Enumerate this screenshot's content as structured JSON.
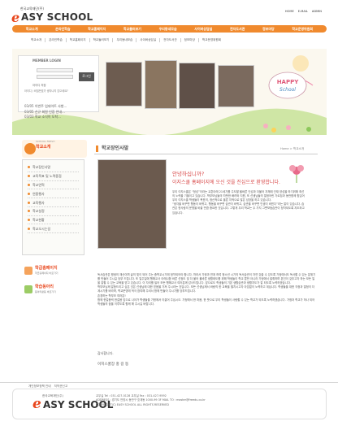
{
  "header": {
    "logo_small": "한국교육재단(주)",
    "logo_e": "e",
    "logo_rest": "ASY SCHOOL",
    "top_links": [
      "HOME",
      "E-MAIL",
      "ADMIN"
    ]
  },
  "gnb": [
    "학교소개",
    "온라인학습",
    "학교홈페이지",
    "학교둘러보기",
    "우리동네모습",
    "사이버상담실",
    "전자도서관",
    "정보마당",
    "학교운영위원회"
  ],
  "subnav": [
    "학교소개",
    "온라인학습",
    "학교홈페이지",
    "학교둘러보기",
    "우리동네모습",
    "사이버상담실",
    "전자도서관",
    "정보마당",
    "학교운영위원회"
  ],
  "login": {
    "title": "MEMBER LOGIN",
    "button": "로그인",
    "remember": "아이디 저장",
    "links": "아이디 / 비밀번호가 생각나지 않으세요?",
    "notices": [
      {
        "date": "03/05",
        "text": "이번주 업데이트 사항..."
      },
      {
        "date": "03/05",
        "text": "신규 회원 인증 안내..."
      },
      {
        "date": "03/03",
        "text": "학교 소식이 도착..."
      }
    ]
  },
  "visual": {
    "happy": "HAPPY School"
  },
  "lnb": {
    "head_small": "SCHOOL FRESH",
    "head": "학교소개",
    "items": [
      "학교장인사말",
      "교육목표 및 노력중점",
      "학교연혁",
      "연중행사",
      "교육행사",
      "학교실정",
      "학교현황",
      "학교오시는길"
    ]
  },
  "banners": [
    {
      "title": "학급홈페이지",
      "sub": "학급홈페이지 바로가기"
    },
    {
      "title": "학습동아리",
      "sub": "동아리활동 바로가기"
    }
  ],
  "content": {
    "title": "학교장인사말",
    "breadcrumb": "Home > 학교소개",
    "hello": "안녕하십니까?",
    "welcome": "이지스쿨 홈페이지에 오신 것을 진심으로 환영합니다.",
    "para1": "우리 이지스쿨은 “정성”이라는 교훈아래 21세기를 주도할 올바른 인성과 더불어 자체에 인재 양성을 하기위해 최선의 노력을 기울이고 있습니다. 학부모님들의 따뜻한 배려와 지원, 또 선생님들의 열정어린 가르침과 동반함께 힘입어 우리 이지스쿨 학생들이 목표의, 정신적으로 올른 지적으로 많은 성장을 하고 있습니다.\n“생각을 바꾸면 행동이 바뀌고, 행동을 바꾸면 습관이 바뀌고, 습관을 바꾸면 인생이 바뀐다”라는 말이 있습니다. 습관은 한사람의 운명을 바꿀 만큼 중요한 것입니다. 그렇게 우리 학교는 두 가지 그릇보듬습관이 정착되도록 지도하고 있습니다.",
    "para2": "독서습관은 평생의 재산이며 삶의 빛이 되어 주는 중학교시기에 정착되어야 합니다. 따라서 가정과 연계 하여 청소년 시기의 독서습관이 자연 갖출 수 있도록 가정에서도 독서할 수 있는 분위기를 만들어 주시길 당부 드립니다. 또 일주일에 행해교사 아래나환 바른 선정도 및 더 불어 올바른 생활태도를 위해 학생들이 학교 뿐만 아니라 가정에서 발휘하며 본인이 갖추고자 하는 모든 일을 잘할 수 있는 교육을 받고 있습니다. 이 자리를 빌어 모든 행해교사 여러분께 감사드립니다. 앞으로도 학생들의 기본 생활습관과 생활지도가 잘 되도록 노력하겠습니다.\n학부모님께 말씀드리고 싶은 것은 선생님에 대한 믿음을 가져 주시라는 것입니다. 모든 선생님께서 바람직 한 교육을 펼치시고자 아낌없이 노력하고 계십니다. 학생들을 대한 걱정과 열정이 더 계시기를 바라며, 학교운영에 적극 참여해 주셔서 함께 만들어 주시기를 당부드립니다.\n존경하는 학부모 여러분!\n함께 한걸음씩 한걸음 앞으로 나아가 학생들을 가정에서 이끌어 주십시오. 가정에서 한 마음, 한 뜻으로 우리 학생들이 사랑할 수 있는 학교가 되도록 노력하겠습니다. 가정과 학교가 하나 되어 학생들의 꿈을 이루도록 함께 해 주시길 바랍니다.",
    "sign1": "감사합니다.",
    "sign2": "이지스쿨장 홍 길 동"
  },
  "footer": {
    "links": [
      "개인정보정책 안내",
      "저작권신고"
    ],
    "logo_small": "한국교육재단(주)",
    "logo_e": "e",
    "logo_rest": "ASY SCHOOL",
    "info": "교무실 Tel : 031-427-0128   교무실 Fax : 031-427-9592\nADDRESS : 경기도 안양시 동안구 호계동 1000-99 3F  MAIL TO : master@freedu.co.kr\nCOPYRIGHT(C) EASY SCHOOL ALL RIGHTS RESERVED"
  },
  "colors": {
    "accent": "#f08a2e",
    "brand": "#e8461c"
  }
}
